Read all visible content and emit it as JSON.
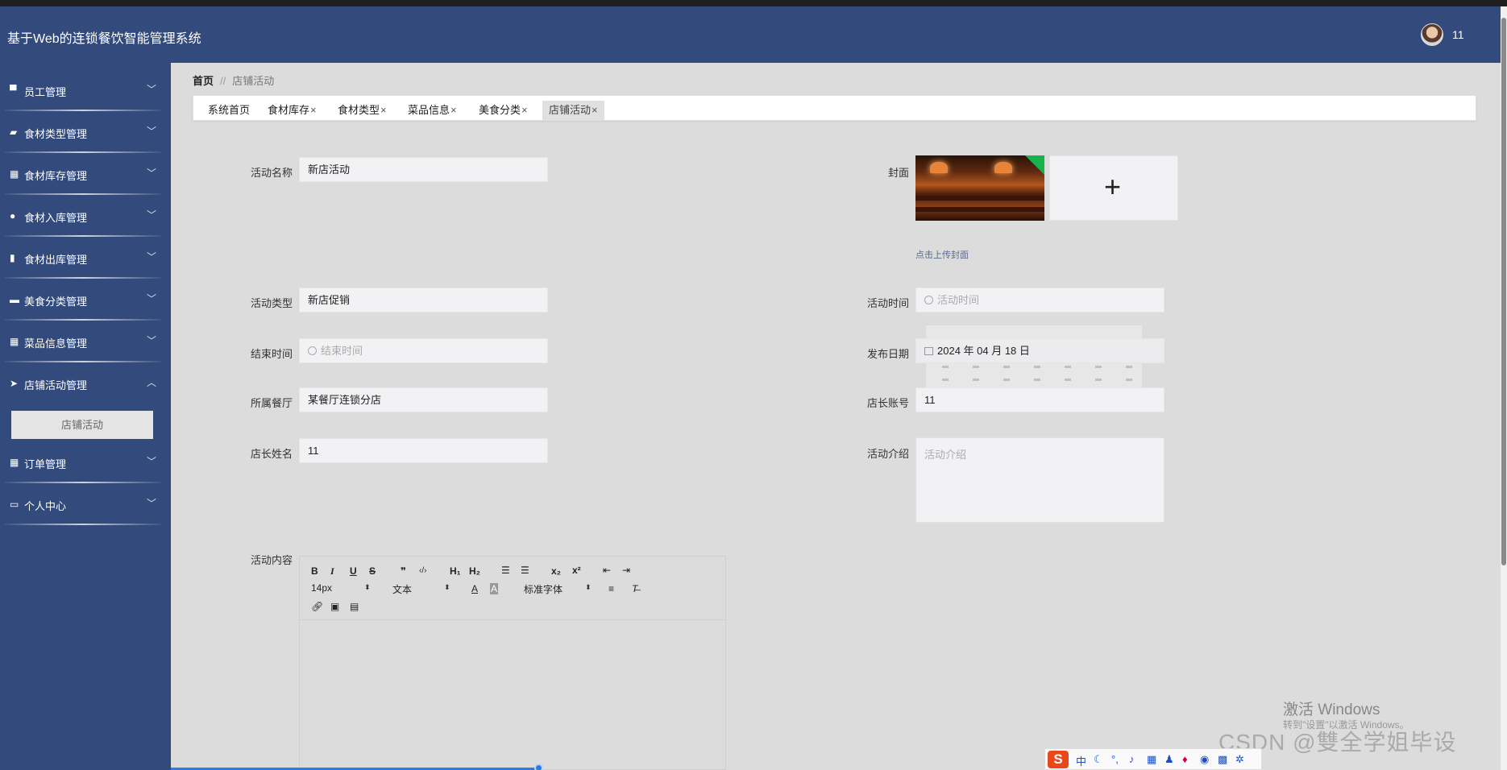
{
  "header": {
    "title": "基于Web的连锁餐饮智能管理系统",
    "username": "11"
  },
  "sidebar": {
    "items": [
      {
        "label": "员工管理",
        "icon": "monitor-icon"
      },
      {
        "label": "食材类型管理",
        "icon": "thumbs-up-icon"
      },
      {
        "label": "食材库存管理",
        "icon": "grid-icon"
      },
      {
        "label": "食材入库管理",
        "icon": "bulb-icon"
      },
      {
        "label": "食材出库管理",
        "icon": "bar-chart-icon"
      },
      {
        "label": "美食分类管理",
        "icon": "chat-icon"
      },
      {
        "label": "菜品信息管理",
        "icon": "grid-icon"
      },
      {
        "label": "店铺活动管理",
        "icon": "paper-plane-icon"
      },
      {
        "label": "订单管理",
        "icon": "grid-icon"
      },
      {
        "label": "个人中心",
        "icon": "window-icon"
      }
    ],
    "submenu_label": "店铺活动"
  },
  "breadcrumb": {
    "home": "首页",
    "separator": "//",
    "current": "店铺活动"
  },
  "tabs": [
    {
      "label": "系统首页",
      "closable": false
    },
    {
      "label": "食材库存",
      "closable": true
    },
    {
      "label": "食材类型",
      "closable": true
    },
    {
      "label": "菜品信息",
      "closable": true
    },
    {
      "label": "美食分类",
      "closable": true
    },
    {
      "label": "店铺活动",
      "closable": true,
      "active": true
    }
  ],
  "tab_close": "×",
  "form": {
    "name_label": "活动名称",
    "name_value": "新店活动",
    "cover_label": "封面",
    "cover_hint": "点击上传封面",
    "type_label": "活动类型",
    "type_value": "新店促销",
    "time_label": "活动时间",
    "time_placeholder": "活动时间",
    "end_label": "结束时间",
    "end_placeholder": "结束时间",
    "publish_label": "发布日期",
    "publish_value": "2024 年 04 月 18 日",
    "restaurant_label": "所属餐厅",
    "restaurant_value": "某餐厅连锁分店",
    "manager_account_label": "店长账号",
    "manager_account_value": "11",
    "manager_name_label": "店长姓名",
    "manager_name_value": "11",
    "intro_label": "活动介绍",
    "intro_placeholder": "活动介绍",
    "content_label": "活动内容"
  },
  "editor": {
    "font_size": "14px",
    "paragraph": "文本",
    "font_family": "标准字体",
    "h1": "H₁",
    "h2": "H₂",
    "sub": "x₂",
    "sup": "x²"
  },
  "watermark": {
    "line1": "激活 Windows",
    "line2": "转到\"设置\"以激活 Windows。",
    "csdn": "CSDN @雙全学姐毕设"
  },
  "ime": {
    "mode": "中"
  },
  "colors": {
    "header_bg": "#334a7c",
    "sidebar_bg": "#334a7c",
    "content_bg": "#dcdcdc",
    "input_bg": "#f2f1f4"
  }
}
